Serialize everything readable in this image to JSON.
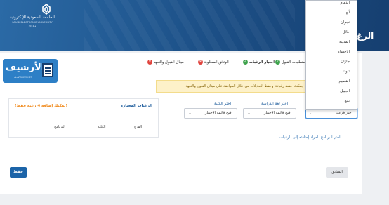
{
  "header": {
    "logo_ar": "الجامعة السعودية الإلكترونية",
    "logo_en": "SAUDI ELECTRONIC UNIVERSITY",
    "logo_year": "2011 م",
    "title": "الرغ"
  },
  "steps": [
    {
      "label": "متطلبات القبول",
      "status": "done"
    },
    {
      "label": "اختيار الرغبات",
      "status": "active"
    },
    {
      "label": "الوثائق المطلوبة",
      "status": "error"
    },
    {
      "label": "ميثاق القبول والتعهد",
      "status": "error"
    }
  ],
  "archive": {
    "word": "الأرشيف",
    "url": "ALARSHEEF.NET"
  },
  "alert": {
    "text": "يمكنك حفظ رغباتك وحفظ التعديلات من خلال الموافقة على ميثاق القبول والتعهد"
  },
  "selected": {
    "title": "الرغبات المختارة",
    "note": "(يمكنك إضافة 4 رغبة فقط)",
    "columns": [
      "الفرع",
      "الكلية",
      "البرنامج"
    ]
  },
  "form": {
    "branch_label": "اختر فرعك",
    "branch_value": "اختر فرعك",
    "language_label": "اختر لغة الدراسة",
    "language_value": "افتح قائمة الاختيار",
    "college_label": "اختر الكلية",
    "college_value": "افتح قائمة الاختيار",
    "hint": "اختر البرنامج المراد إضافته إلى الرغبات"
  },
  "buttons": {
    "save": "حفظ",
    "previous": "السابق"
  },
  "dropdown": {
    "options": [
      "الدمام",
      "أبها",
      "نجران",
      "حائل",
      "المدينة",
      "الاحساء",
      "جازان",
      "تبوك",
      "القصيم",
      "الجبيل",
      "ينبع"
    ]
  }
}
